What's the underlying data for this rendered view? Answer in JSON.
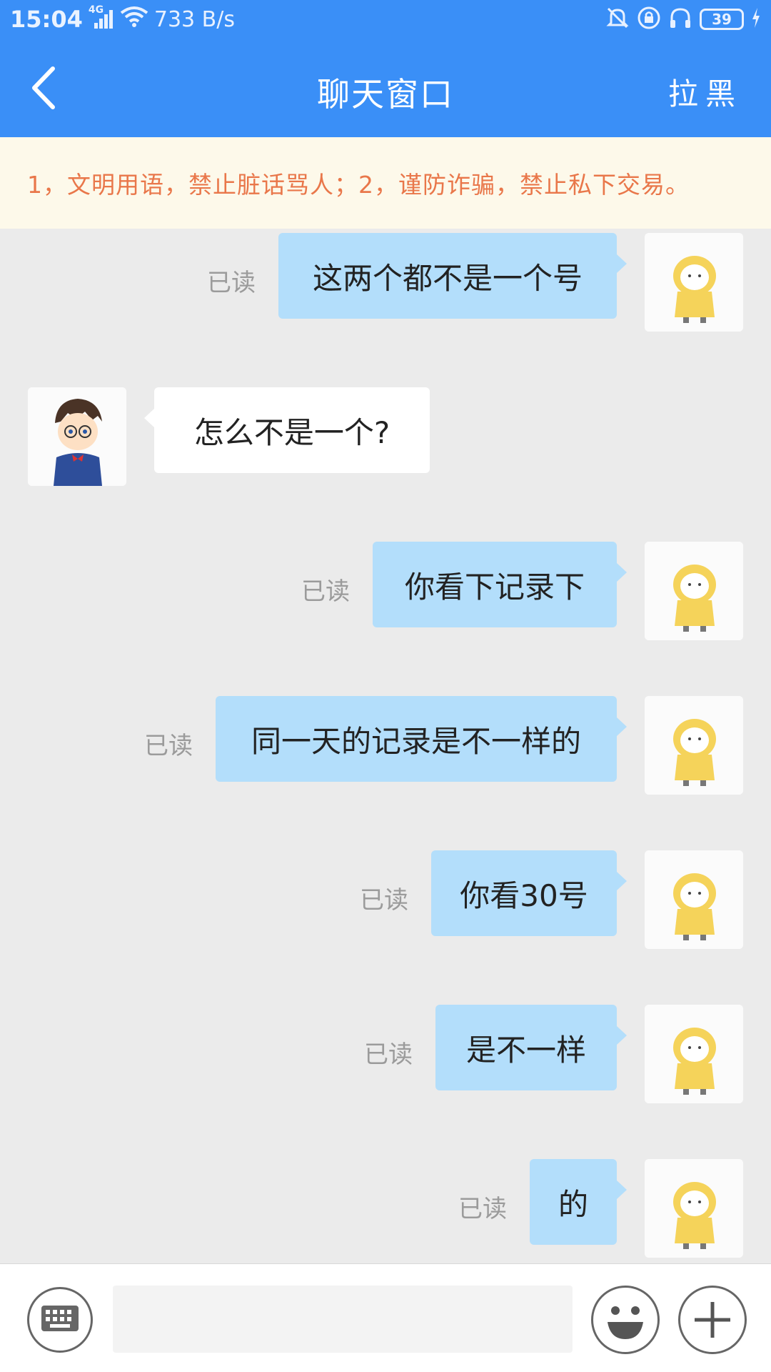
{
  "status_bar": {
    "time": "15:04",
    "network": "4G",
    "speed": "733 B/s",
    "battery": "39"
  },
  "header": {
    "back_icon": "chevron-left-icon",
    "title": "聊天窗口",
    "action": "拉黑"
  },
  "notice": {
    "text": "1，文明用语，禁止脏话骂人；2，谨防诈骗，禁止私下交易。"
  },
  "messages": [
    {
      "side": "me",
      "text": "这两个都不是一个号",
      "read": "已读"
    },
    {
      "side": "them",
      "text": "怎么不是一个?",
      "read": ""
    },
    {
      "side": "me",
      "text": "你看下记录下",
      "read": "已读"
    },
    {
      "side": "me",
      "text": "同一天的记录是不一样的",
      "read": "已读"
    },
    {
      "side": "me",
      "text": "你看30号",
      "read": "已读"
    },
    {
      "side": "me",
      "text": "是不一样",
      "read": "已读"
    },
    {
      "side": "me",
      "text": "的",
      "read": "已读"
    }
  ],
  "bottom_bar": {
    "keyboard_icon": "keyboard-icon",
    "input_value": "",
    "emoji_icon": "smiley-icon",
    "plus_icon": "plus-icon"
  },
  "colors": {
    "header_bg": "#3a8ff7",
    "notice_bg": "#fdf9ea",
    "notice_text": "#e9774a",
    "my_bubble": "#b3defb",
    "their_bubble": "#ffffff",
    "chat_bg": "#ebebeb"
  }
}
